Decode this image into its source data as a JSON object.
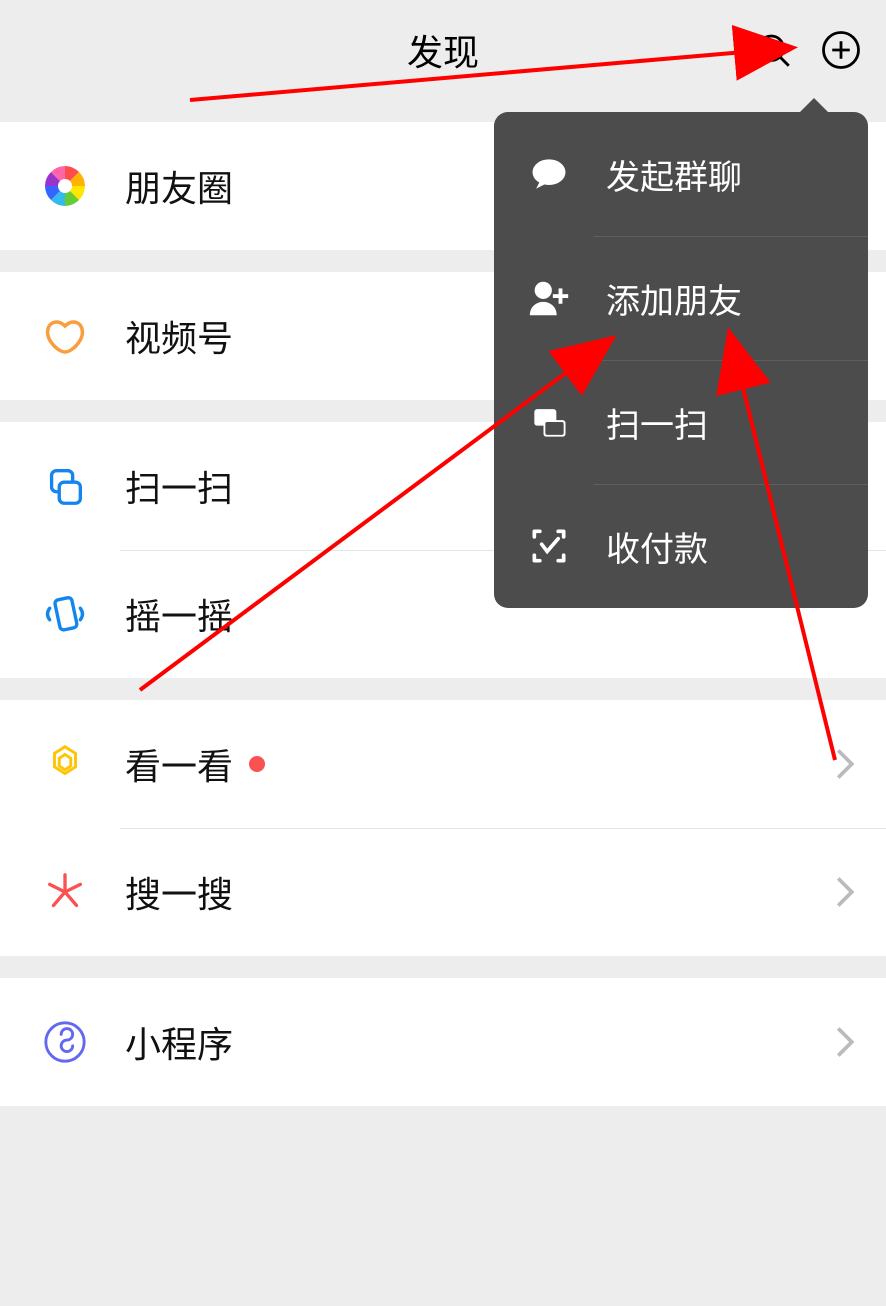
{
  "header": {
    "title": "发现"
  },
  "rows": {
    "moments": {
      "label": "朋友圈"
    },
    "channels": {
      "label": "视频号"
    },
    "scan": {
      "label": "扫一扫"
    },
    "shake": {
      "label": "摇一摇"
    },
    "topstories": {
      "label": "看一看"
    },
    "search": {
      "label": "搜一搜"
    },
    "miniprograms": {
      "label": "小程序"
    }
  },
  "popup": {
    "group_chat": {
      "label": "发起群聊"
    },
    "add_friend": {
      "label": "添加朋友"
    },
    "scan": {
      "label": "扫一扫"
    },
    "pay": {
      "label": "收付款"
    }
  },
  "colors": {
    "accent_red": "#fa5151",
    "popup_bg": "#4c4c4c",
    "page_bg": "#ededed"
  }
}
